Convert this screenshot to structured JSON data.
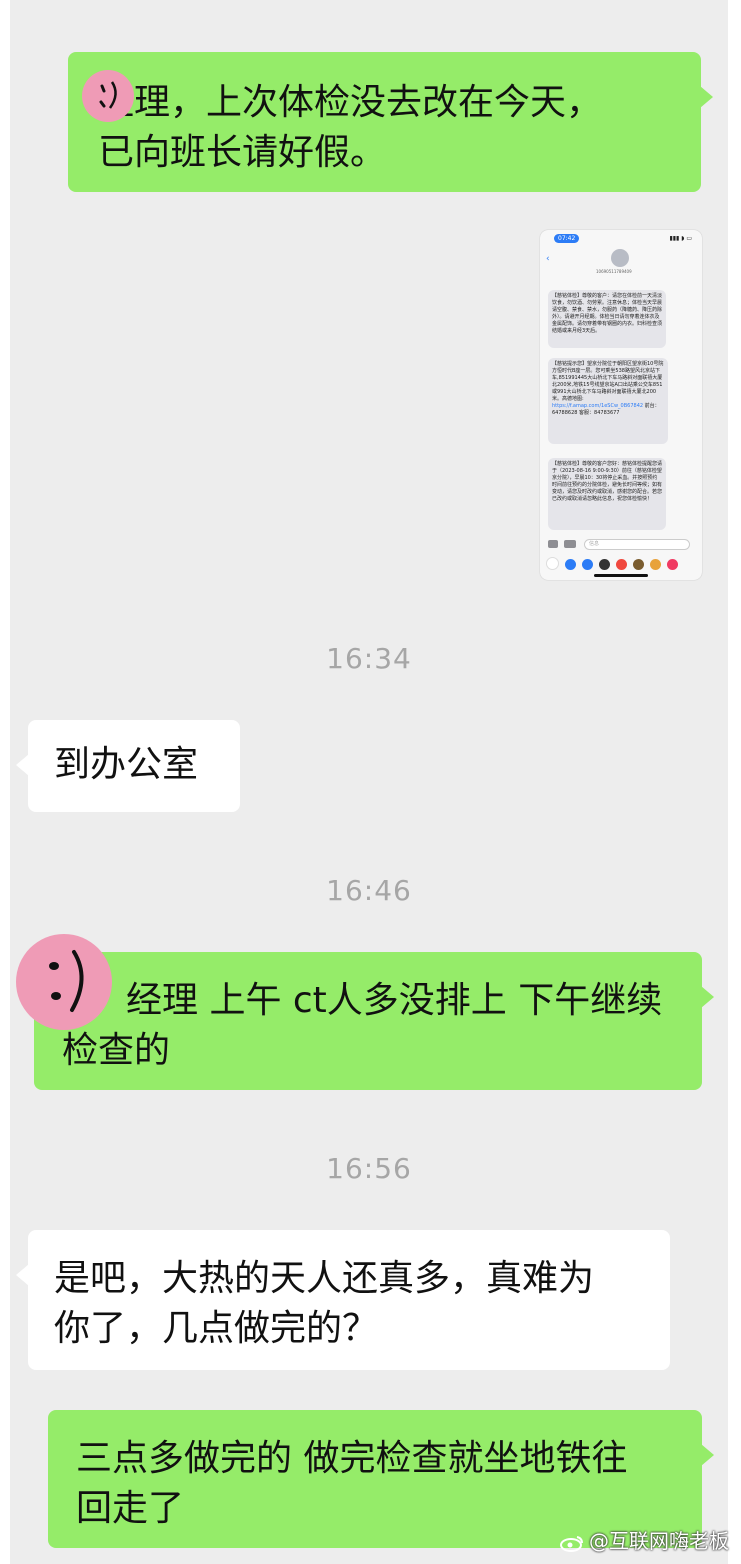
{
  "chat": {
    "messages": [
      {
        "direction": "out",
        "text": "经理，上次体检没去改在今天，已向班长请好假。"
      },
      {
        "type": "image",
        "direction": "out",
        "description_icon": "screenshot-thumbnail"
      },
      {
        "type": "time",
        "text": "16:34"
      },
      {
        "direction": "in",
        "text": "到办公室"
      },
      {
        "type": "time",
        "text": "16:46"
      },
      {
        "direction": "out",
        "text": "经理 上午 ct人多没排上 下午继续检查的"
      },
      {
        "type": "time",
        "text": "16:56"
      },
      {
        "direction": "in",
        "text": "是吧，大热的天人还真多，真难为你了，几点做完的？"
      },
      {
        "direction": "out",
        "text": "三点多做完的 做完检查就坐地铁往回走了"
      }
    ],
    "colors": {
      "outgoing": "#95ec69",
      "incoming": "#ffffff",
      "background": "#ededed",
      "time": "#a6a6a6"
    }
  },
  "msg1": {
    "line1": "经理，上次体检没去改在今天，",
    "line2": "已向班长请好假。"
  },
  "time1": "16:34",
  "msg2": "到办公室",
  "time2": "16:46",
  "msg3": {
    "line1": "经理 上午 ct人多没排上 下午继续",
    "line2": "检查的"
  },
  "time3": "16:56",
  "msg4": {
    "line1": "是吧，大热的天人还真多，真难为",
    "line2": "你了，几点做完的？"
  },
  "msg5": {
    "line1": "三点多做完的 做完检查就坐地铁往",
    "line2": "回走了"
  },
  "thumbnail": {
    "clock": "07:42",
    "number": "10690511789409",
    "sms1": "【慈铭体检】尊敬的客户：请您在体检前一天清淡饮食，勿饮酒、勿劳累。注意休息；体检当天早晨请空腹、禁食、禁水，勿服药（降糖药、降压药除外）。请避开月经期。体检当日请勿穿着连体衣及金属配饰。请勿穿着带有钢圈的内衣。妇科检查须结婚或来月经3天后。",
    "sms2": "【慈铭提示您】望京分院位于朝阳区望京街10号院方恒时代B座一层。您可乘坐538路望风北京站下车,851991445大山桥北下车马路斜对面联禧大厦北200米,地铁15号线望京站A口出站乘公交车851或991大山桥北下车马路斜对面联禧大厦北200米。高德地图:",
    "sms2_link": "https://f.amap.com/1eSCw_0B67842",
    "sms2_tail": "前台：64788628 客服：84783677",
    "sms3": "【慈铭体检】尊敬的客户您好：慈铭体检提醒您请于（2023-08-16 9:00-9:30）前往（慈铭体检望京分院），早晨10：30将停止采血。并按照预约时间前往预约的分院体检，避免长时间等候；如有变动，请您及时改约或取消，感谢您的配合。若您已改约或取消请忽略此信息，祝您体检愉快！",
    "input_placeholder": "信息",
    "dock_colors": [
      "#ffffff",
      "#2c7cf6",
      "#2c7cf6",
      "#333333",
      "#f0483e",
      "#7a5c2e",
      "#e8a23a",
      "#f03a62"
    ]
  },
  "watermark": "@互联网嗨老板"
}
